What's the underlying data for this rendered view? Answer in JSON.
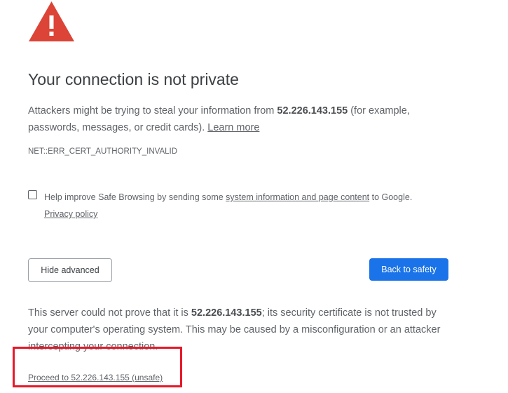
{
  "heading": "Your connection is not private",
  "intro": {
    "before": "Attackers might be trying to steal your information from ",
    "host": "52.226.143.155",
    "after": " (for example, passwords, messages, or credit cards). ",
    "learn_more": "Learn more"
  },
  "error_code": "NET::ERR_CERT_AUTHORITY_INVALID",
  "safe_browsing": {
    "checked": false,
    "before": "Help improve Safe Browsing by sending some ",
    "link": "system information and page content",
    "after": " to Google.",
    "privacy_link": "Privacy policy"
  },
  "buttons": {
    "hide_advanced": "Hide advanced",
    "back_to_safety": "Back to safety"
  },
  "details": {
    "before": "This server could not prove that it is ",
    "host": "52.226.143.155",
    "after": "; its security certificate is not trusted by your computer's operating system. This may be caused by a misconfiguration or an attacker intercepting your connection."
  },
  "proceed_link": "Proceed to 52.226.143.155 (unsafe)",
  "colors": {
    "warning_icon": "#db4437",
    "primary_button": "#1a73e8",
    "highlight": "#e8182a"
  }
}
